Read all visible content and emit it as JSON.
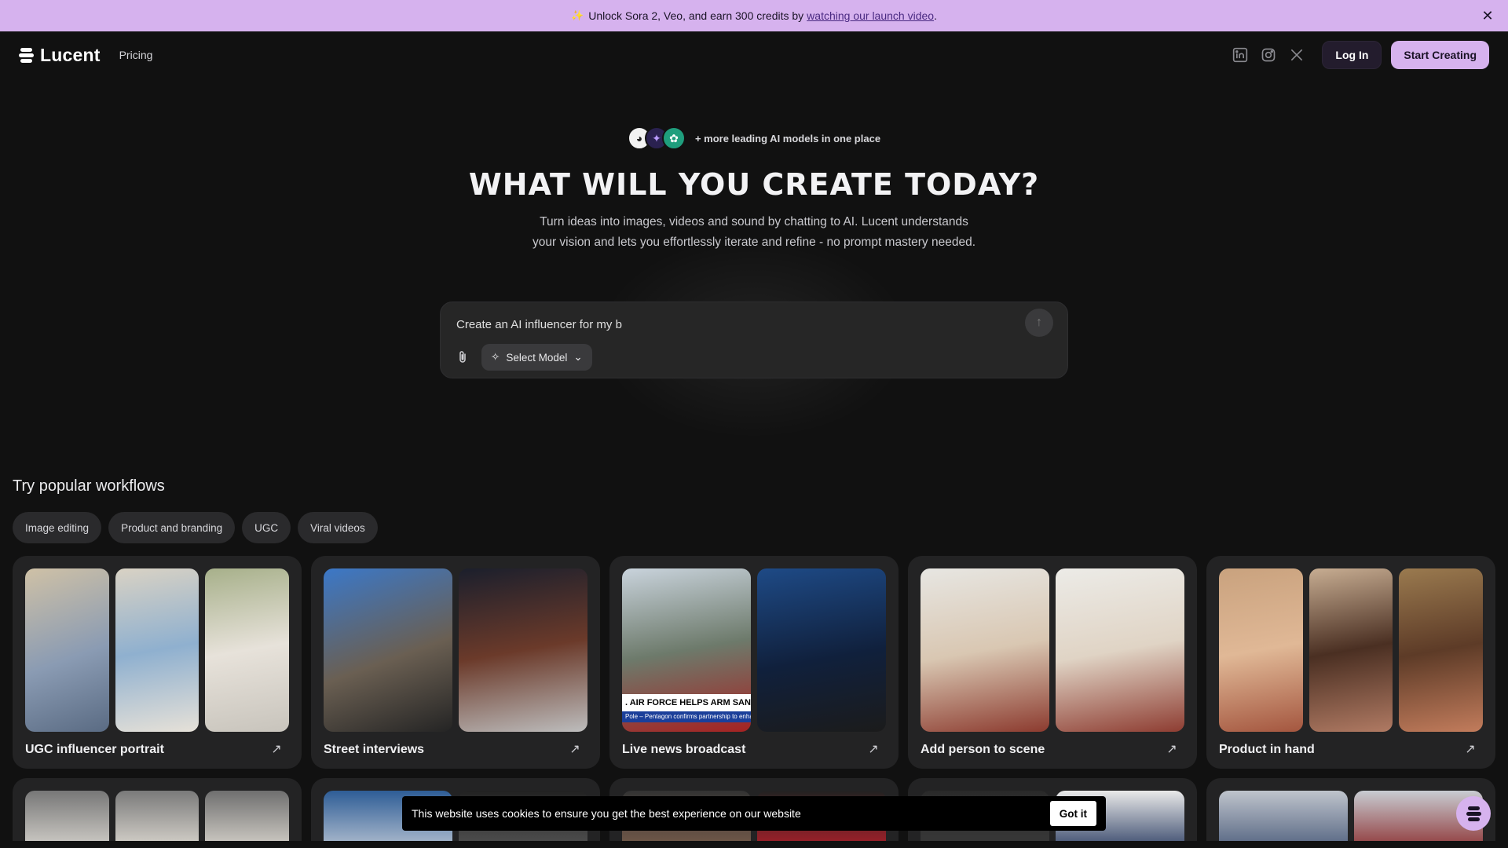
{
  "banner": {
    "text": "Unlock Sora 2, Veo, and earn 300 credits by",
    "link": "watching our launch video",
    "suffix": ".",
    "close_icon": "close-icon"
  },
  "header": {
    "brand": "Lucent",
    "nav_pricing": "Pricing",
    "social_icons": [
      "linkedin-icon",
      "instagram-icon",
      "x-icon"
    ],
    "login": "Log In",
    "start": "Start Creating"
  },
  "hero": {
    "models_text": "+ more leading AI models in one place",
    "title": "WHAT WILL YOU CREATE TODAY?",
    "subtitle_line1": "Turn ideas into images, videos and sound by chatting to AI. Lucent understands",
    "subtitle_line2": "your vision and lets you effortlessly iterate and refine - no prompt mastery needed."
  },
  "prompt": {
    "value": "Create an AI influencer for my b",
    "select_model": "Select Model"
  },
  "workflows": {
    "heading": "Try popular workflows",
    "chips": [
      "Image editing",
      "Product and branding",
      "UGC",
      "Viral videos"
    ],
    "cards": [
      {
        "title": "UGC influencer portrait"
      },
      {
        "title": "Street interviews"
      },
      {
        "title": "Live news broadcast",
        "ticker": ". AIR FORCE HELPS ARM SAN",
        "subticker": "Pole – Pentagon confirms partnership to enha"
      },
      {
        "title": "Add person to scene"
      },
      {
        "title": "Product in hand"
      }
    ]
  },
  "cookie": {
    "text": "This website uses cookies to ensure you get the best experience on our website",
    "button": "Got it"
  },
  "colors": {
    "accent": "#d6b2ee",
    "background": "#111111",
    "card": "#232324"
  }
}
